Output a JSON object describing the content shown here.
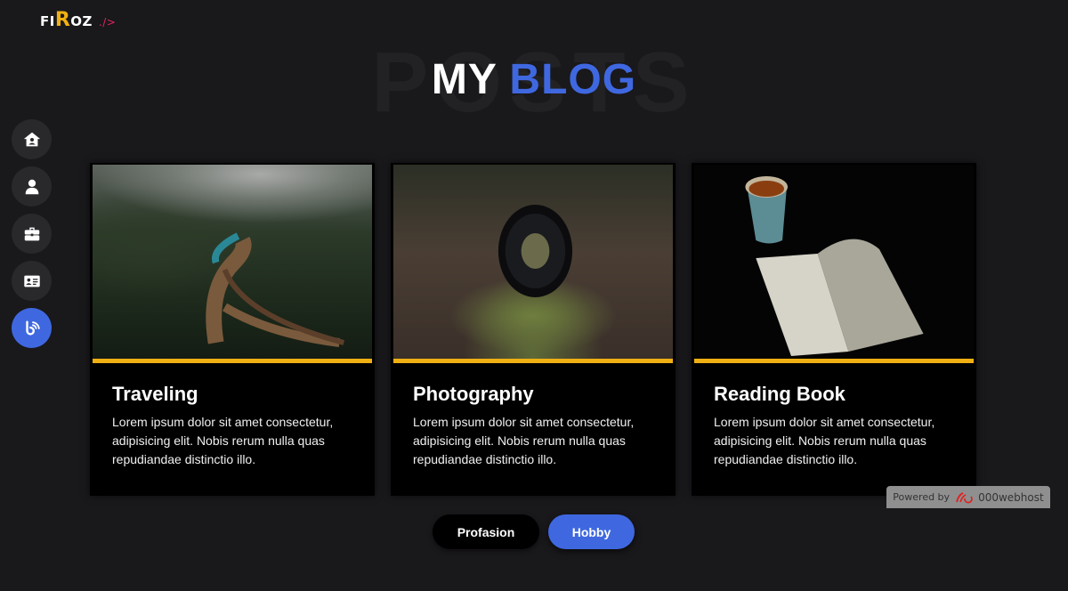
{
  "logo": {
    "prefix": "FI",
    "highlight": "R",
    "suffix": "OZ",
    "tag": "./>"
  },
  "header": {
    "background_word": "POSTS",
    "title_main": "MY",
    "title_accent": "BLOG"
  },
  "sidebar": {
    "items": [
      {
        "name": "home",
        "icon": "house-user-icon",
        "active": false
      },
      {
        "name": "about",
        "icon": "user-icon",
        "active": false
      },
      {
        "name": "portfolio",
        "icon": "briefcase-icon",
        "active": false
      },
      {
        "name": "contact",
        "icon": "id-card-icon",
        "active": false
      },
      {
        "name": "blog",
        "icon": "blogger-icon",
        "active": true
      }
    ]
  },
  "cards": [
    {
      "title": "Traveling",
      "image": "train-on-forest-bridge",
      "text": "Lorem ipsum dolor sit amet consectetur, adipisicing elit. Nobis rerum nulla quas repudiandae distinctio illo."
    },
    {
      "title": "Photography",
      "image": "camera-lens-on-mossy-log",
      "text": "Lorem ipsum dolor sit amet consectetur, adipisicing elit. Nobis rerum nulla quas repudiandae distinctio illo."
    },
    {
      "title": "Reading Book",
      "image": "tea-cup-and-open-book",
      "text": "Lorem ipsum dolor sit amet consectetur, adipisicing elit. Nobis rerum nulla quas repudiandae distinctio illo."
    }
  ],
  "tabs": [
    {
      "label": "Profasion",
      "active": false
    },
    {
      "label": "Hobby",
      "active": true
    }
  ],
  "badge": {
    "prefix": "Powered by",
    "brand": "000webhost"
  },
  "colors": {
    "accent": "#3f68e0",
    "highlight": "#f0b014",
    "background": "#19181b",
    "tag": "#e0265c"
  }
}
